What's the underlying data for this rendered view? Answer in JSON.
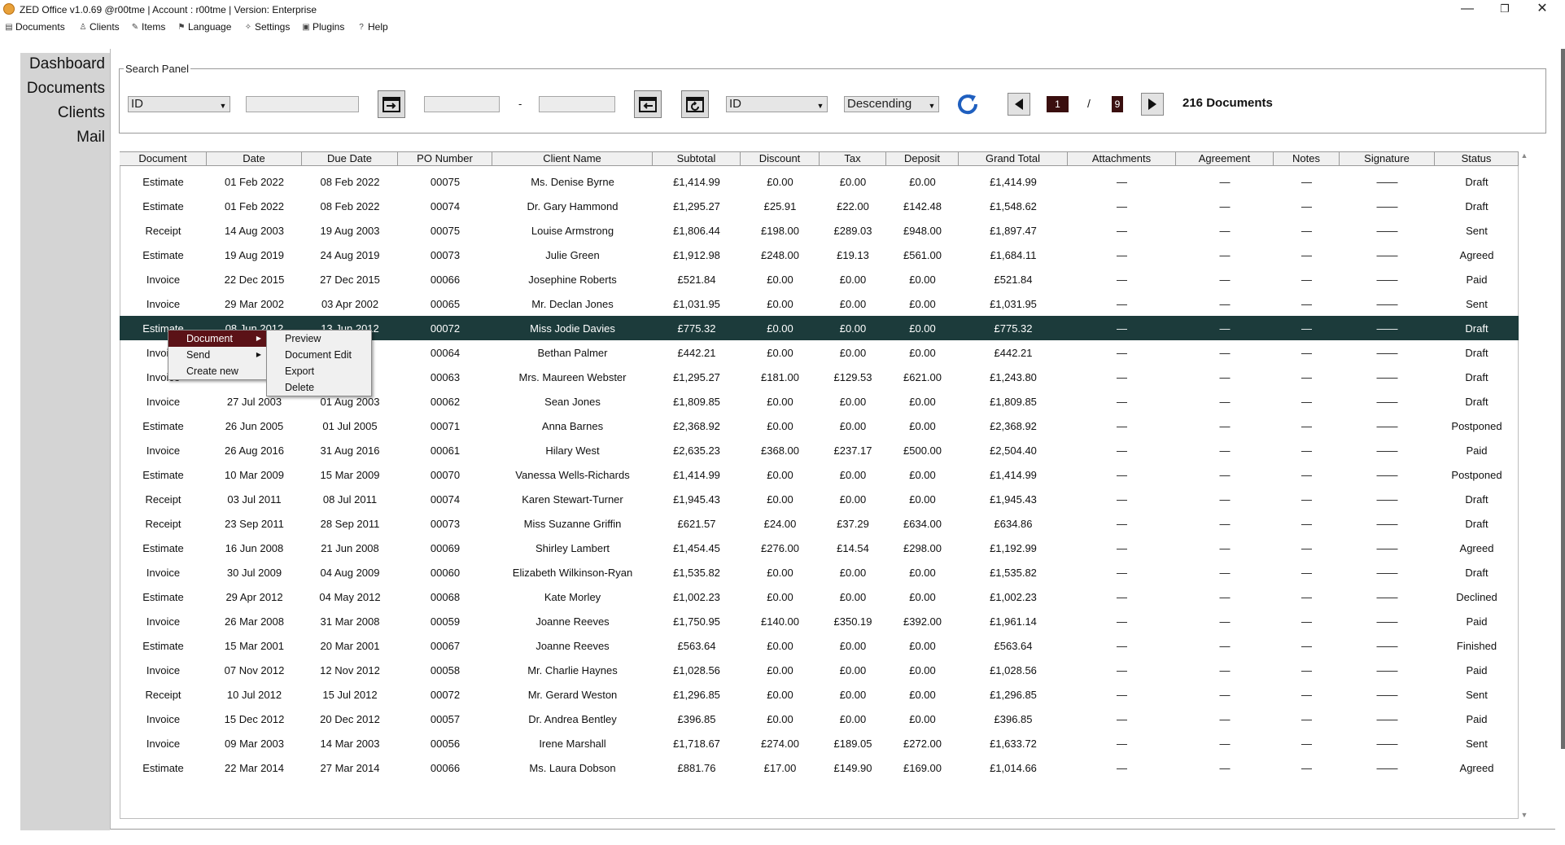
{
  "window": {
    "title": "ZED Office  v1.0.69 @r00tme  | Account : r00tme | Version: Enterprise",
    "controls": {
      "minimize": "—",
      "restore": "❐",
      "close": "✕"
    }
  },
  "menubar": [
    {
      "label": "Documents",
      "icon": "document-icon"
    },
    {
      "label": "Clients",
      "icon": "person-icon"
    },
    {
      "label": "Items",
      "icon": "pencil-icon"
    },
    {
      "label": "Language",
      "icon": "flag-icon"
    },
    {
      "label": "Settings",
      "icon": "wrench-icon"
    },
    {
      "label": "Plugins",
      "icon": "plugin-icon"
    },
    {
      "label": "Help",
      "icon": "question-icon"
    }
  ],
  "sidebar": {
    "items": [
      {
        "label": "Dashboard"
      },
      {
        "label": "Documents"
      },
      {
        "label": "Clients"
      },
      {
        "label": "Mail"
      }
    ]
  },
  "search": {
    "legend": "Search Panel",
    "filter_field": "ID",
    "filter_value": "",
    "date_from": "",
    "date_separator": "-",
    "date_to": "",
    "sort_field": "ID",
    "sort_order": "Descending",
    "current_page": "1",
    "page_separator": "/",
    "total_pages": "9",
    "total_label": "216 Documents"
  },
  "colors": {
    "selected_row": "#1c3b3b",
    "menu_active": "#5b1217",
    "page_box": "#3a0f0f"
  },
  "table": {
    "columns": [
      "Document",
      "Date",
      "Due Date",
      "PO Number",
      "Client Name",
      "Subtotal",
      "Discount",
      "Tax",
      "Deposit",
      "Grand Total",
      "Attachments",
      "Agreement",
      "Notes",
      "Signature",
      "Status"
    ],
    "rows": [
      [
        "Estimate",
        "01 Feb 2022",
        "08 Feb 2022",
        "00075",
        "Ms. Denise Byrne",
        "£1,414.99",
        "£0.00",
        "£0.00",
        "£0.00",
        "£1,414.99",
        "—",
        "—",
        "—",
        "——",
        "Draft"
      ],
      [
        "Estimate",
        "01 Feb 2022",
        "08 Feb 2022",
        "00074",
        "Dr. Gary Hammond",
        "£1,295.27",
        "£25.91",
        "£22.00",
        "£142.48",
        "£1,548.62",
        "—",
        "—",
        "—",
        "——",
        "Draft"
      ],
      [
        "Receipt",
        "14 Aug 2003",
        "19 Aug 2003",
        "00075",
        "Louise Armstrong",
        "£1,806.44",
        "£198.00",
        "£289.03",
        "£948.00",
        "£1,897.47",
        "—",
        "—",
        "—",
        "——",
        "Sent"
      ],
      [
        "Estimate",
        "19 Aug 2019",
        "24 Aug 2019",
        "00073",
        "Julie Green",
        "£1,912.98",
        "£248.00",
        "£19.13",
        "£561.00",
        "£1,684.11",
        "—",
        "—",
        "—",
        "——",
        "Agreed"
      ],
      [
        "Invoice",
        "22 Dec 2015",
        "27 Dec 2015",
        "00066",
        "Josephine Roberts",
        "£521.84",
        "£0.00",
        "£0.00",
        "£0.00",
        "£521.84",
        "—",
        "—",
        "—",
        "——",
        "Paid"
      ],
      [
        "Invoice",
        "29 Mar 2002",
        "03 Apr 2002",
        "00065",
        "Mr. Declan Jones",
        "£1,031.95",
        "£0.00",
        "£0.00",
        "£0.00",
        "£1,031.95",
        "—",
        "—",
        "—",
        "——",
        "Sent"
      ],
      [
        "Estimate",
        "08 Jun 2012",
        "13 Jun 2012",
        "00072",
        "Miss Jodie Davies",
        "£775.32",
        "£0.00",
        "£0.00",
        "£0.00",
        "£775.32",
        "—",
        "—",
        "—",
        "——",
        "Draft"
      ],
      [
        "Invoice",
        "",
        "7",
        "00064",
        "Bethan Palmer",
        "£442.21",
        "£0.00",
        "£0.00",
        "£0.00",
        "£442.21",
        "—",
        "—",
        "—",
        "——",
        "Draft"
      ],
      [
        "Invoice",
        "",
        "6",
        "00063",
        "Mrs. Maureen Webster",
        "£1,295.27",
        "£181.00",
        "£129.53",
        "£621.00",
        "£1,243.80",
        "—",
        "—",
        "—",
        "——",
        "Draft"
      ],
      [
        "Invoice",
        "27 Jul 2003",
        "01 Aug 2003",
        "00062",
        "Sean Jones",
        "£1,809.85",
        "£0.00",
        "£0.00",
        "£0.00",
        "£1,809.85",
        "—",
        "—",
        "—",
        "——",
        "Draft"
      ],
      [
        "Estimate",
        "26 Jun 2005",
        "01 Jul 2005",
        "00071",
        "Anna Barnes",
        "£2,368.92",
        "£0.00",
        "£0.00",
        "£0.00",
        "£2,368.92",
        "—",
        "—",
        "—",
        "——",
        "Postponed"
      ],
      [
        "Invoice",
        "26 Aug 2016",
        "31 Aug 2016",
        "00061",
        "Hilary West",
        "£2,635.23",
        "£368.00",
        "£237.17",
        "£500.00",
        "£2,504.40",
        "—",
        "—",
        "—",
        "——",
        "Paid"
      ],
      [
        "Estimate",
        "10 Mar 2009",
        "15 Mar 2009",
        "00070",
        "Vanessa Wells-Richards",
        "£1,414.99",
        "£0.00",
        "£0.00",
        "£0.00",
        "£1,414.99",
        "—",
        "—",
        "—",
        "——",
        "Postponed"
      ],
      [
        "Receipt",
        "03 Jul 2011",
        "08 Jul 2011",
        "00074",
        "Karen Stewart-Turner",
        "£1,945.43",
        "£0.00",
        "£0.00",
        "£0.00",
        "£1,945.43",
        "—",
        "—",
        "—",
        "——",
        "Draft"
      ],
      [
        "Receipt",
        "23 Sep 2011",
        "28 Sep 2011",
        "00073",
        "Miss Suzanne Griffin",
        "£621.57",
        "£24.00",
        "£37.29",
        "£634.00",
        "£634.86",
        "—",
        "—",
        "—",
        "——",
        "Draft"
      ],
      [
        "Estimate",
        "16 Jun 2008",
        "21 Jun 2008",
        "00069",
        "Shirley Lambert",
        "£1,454.45",
        "£276.00",
        "£14.54",
        "£298.00",
        "£1,192.99",
        "—",
        "—",
        "—",
        "——",
        "Agreed"
      ],
      [
        "Invoice",
        "30 Jul 2009",
        "04 Aug 2009",
        "00060",
        "Elizabeth Wilkinson-Ryan",
        "£1,535.82",
        "£0.00",
        "£0.00",
        "£0.00",
        "£1,535.82",
        "—",
        "—",
        "—",
        "——",
        "Draft"
      ],
      [
        "Estimate",
        "29 Apr 2012",
        "04 May 2012",
        "00068",
        "Kate Morley",
        "£1,002.23",
        "£0.00",
        "£0.00",
        "£0.00",
        "£1,002.23",
        "—",
        "—",
        "—",
        "——",
        "Declined"
      ],
      [
        "Invoice",
        "26 Mar 2008",
        "31 Mar 2008",
        "00059",
        "Joanne Reeves",
        "£1,750.95",
        "£140.00",
        "£350.19",
        "£392.00",
        "£1,961.14",
        "—",
        "—",
        "—",
        "——",
        "Paid"
      ],
      [
        "Estimate",
        "15 Mar 2001",
        "20 Mar 2001",
        "00067",
        "Joanne Reeves",
        "£563.64",
        "£0.00",
        "£0.00",
        "£0.00",
        "£563.64",
        "—",
        "—",
        "—",
        "——",
        "Finished"
      ],
      [
        "Invoice",
        "07 Nov 2012",
        "12 Nov 2012",
        "00058",
        "Mr. Charlie Haynes",
        "£1,028.56",
        "£0.00",
        "£0.00",
        "£0.00",
        "£1,028.56",
        "—",
        "—",
        "—",
        "——",
        "Paid"
      ],
      [
        "Receipt",
        "10 Jul 2012",
        "15 Jul 2012",
        "00072",
        "Mr. Gerard Weston",
        "£1,296.85",
        "£0.00",
        "£0.00",
        "£0.00",
        "£1,296.85",
        "—",
        "—",
        "—",
        "——",
        "Sent"
      ],
      [
        "Invoice",
        "15 Dec 2012",
        "20 Dec 2012",
        "00057",
        "Dr. Andrea Bentley",
        "£396.85",
        "£0.00",
        "£0.00",
        "£0.00",
        "£396.85",
        "—",
        "—",
        "—",
        "——",
        "Paid"
      ],
      [
        "Invoice",
        "09 Mar 2003",
        "14 Mar 2003",
        "00056",
        "Irene Marshall",
        "£1,718.67",
        "£274.00",
        "£189.05",
        "£272.00",
        "£1,633.72",
        "—",
        "—",
        "—",
        "——",
        "Sent"
      ],
      [
        "Estimate",
        "22 Mar 2014",
        "27 Mar 2014",
        "00066",
        "Ms. Laura Dobson",
        "£881.76",
        "£17.00",
        "£149.90",
        "£169.00",
        "£1,014.66",
        "—",
        "—",
        "—",
        "——",
        "Agreed"
      ]
    ],
    "selected_row_index": 6
  },
  "context_menu": {
    "items": [
      {
        "label": "Document",
        "has_submenu": true,
        "active": true
      },
      {
        "label": "Send",
        "has_submenu": true,
        "active": false
      },
      {
        "label": "Create new",
        "has_submenu": false,
        "active": false
      }
    ],
    "submenu": [
      {
        "label": "Preview"
      },
      {
        "label": "Document Edit"
      },
      {
        "label": "Export"
      },
      {
        "label": "Delete"
      }
    ]
  }
}
